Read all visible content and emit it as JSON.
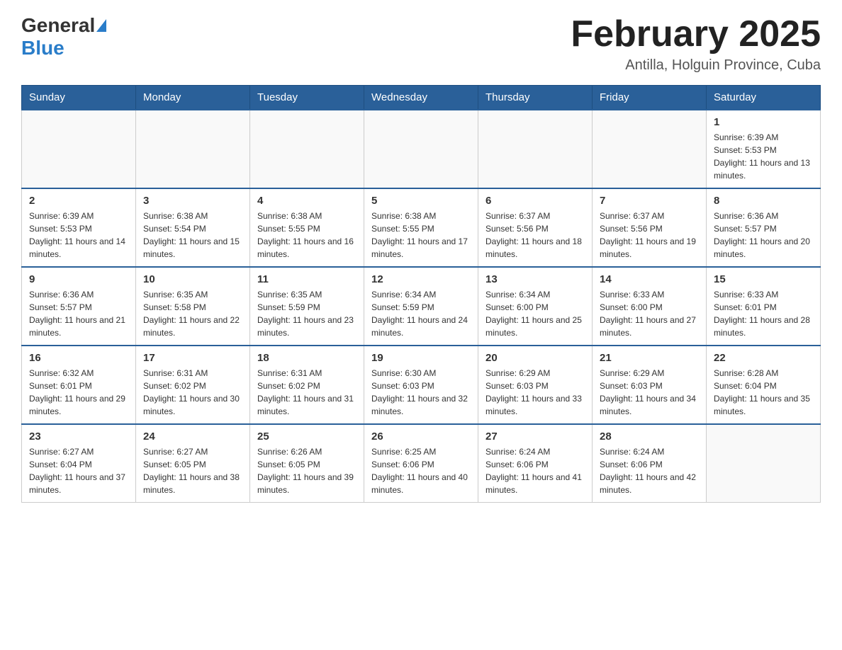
{
  "header": {
    "logo_general": "General",
    "logo_blue": "Blue",
    "month_title": "February 2025",
    "location": "Antilla, Holguin Province, Cuba"
  },
  "weekdays": [
    "Sunday",
    "Monday",
    "Tuesday",
    "Wednesday",
    "Thursday",
    "Friday",
    "Saturday"
  ],
  "weeks": [
    [
      {
        "day": "",
        "info": ""
      },
      {
        "day": "",
        "info": ""
      },
      {
        "day": "",
        "info": ""
      },
      {
        "day": "",
        "info": ""
      },
      {
        "day": "",
        "info": ""
      },
      {
        "day": "",
        "info": ""
      },
      {
        "day": "1",
        "info": "Sunrise: 6:39 AM\nSunset: 5:53 PM\nDaylight: 11 hours and 13 minutes."
      }
    ],
    [
      {
        "day": "2",
        "info": "Sunrise: 6:39 AM\nSunset: 5:53 PM\nDaylight: 11 hours and 14 minutes."
      },
      {
        "day": "3",
        "info": "Sunrise: 6:38 AM\nSunset: 5:54 PM\nDaylight: 11 hours and 15 minutes."
      },
      {
        "day": "4",
        "info": "Sunrise: 6:38 AM\nSunset: 5:55 PM\nDaylight: 11 hours and 16 minutes."
      },
      {
        "day": "5",
        "info": "Sunrise: 6:38 AM\nSunset: 5:55 PM\nDaylight: 11 hours and 17 minutes."
      },
      {
        "day": "6",
        "info": "Sunrise: 6:37 AM\nSunset: 5:56 PM\nDaylight: 11 hours and 18 minutes."
      },
      {
        "day": "7",
        "info": "Sunrise: 6:37 AM\nSunset: 5:56 PM\nDaylight: 11 hours and 19 minutes."
      },
      {
        "day": "8",
        "info": "Sunrise: 6:36 AM\nSunset: 5:57 PM\nDaylight: 11 hours and 20 minutes."
      }
    ],
    [
      {
        "day": "9",
        "info": "Sunrise: 6:36 AM\nSunset: 5:57 PM\nDaylight: 11 hours and 21 minutes."
      },
      {
        "day": "10",
        "info": "Sunrise: 6:35 AM\nSunset: 5:58 PM\nDaylight: 11 hours and 22 minutes."
      },
      {
        "day": "11",
        "info": "Sunrise: 6:35 AM\nSunset: 5:59 PM\nDaylight: 11 hours and 23 minutes."
      },
      {
        "day": "12",
        "info": "Sunrise: 6:34 AM\nSunset: 5:59 PM\nDaylight: 11 hours and 24 minutes."
      },
      {
        "day": "13",
        "info": "Sunrise: 6:34 AM\nSunset: 6:00 PM\nDaylight: 11 hours and 25 minutes."
      },
      {
        "day": "14",
        "info": "Sunrise: 6:33 AM\nSunset: 6:00 PM\nDaylight: 11 hours and 27 minutes."
      },
      {
        "day": "15",
        "info": "Sunrise: 6:33 AM\nSunset: 6:01 PM\nDaylight: 11 hours and 28 minutes."
      }
    ],
    [
      {
        "day": "16",
        "info": "Sunrise: 6:32 AM\nSunset: 6:01 PM\nDaylight: 11 hours and 29 minutes."
      },
      {
        "day": "17",
        "info": "Sunrise: 6:31 AM\nSunset: 6:02 PM\nDaylight: 11 hours and 30 minutes."
      },
      {
        "day": "18",
        "info": "Sunrise: 6:31 AM\nSunset: 6:02 PM\nDaylight: 11 hours and 31 minutes."
      },
      {
        "day": "19",
        "info": "Sunrise: 6:30 AM\nSunset: 6:03 PM\nDaylight: 11 hours and 32 minutes."
      },
      {
        "day": "20",
        "info": "Sunrise: 6:29 AM\nSunset: 6:03 PM\nDaylight: 11 hours and 33 minutes."
      },
      {
        "day": "21",
        "info": "Sunrise: 6:29 AM\nSunset: 6:03 PM\nDaylight: 11 hours and 34 minutes."
      },
      {
        "day": "22",
        "info": "Sunrise: 6:28 AM\nSunset: 6:04 PM\nDaylight: 11 hours and 35 minutes."
      }
    ],
    [
      {
        "day": "23",
        "info": "Sunrise: 6:27 AM\nSunset: 6:04 PM\nDaylight: 11 hours and 37 minutes."
      },
      {
        "day": "24",
        "info": "Sunrise: 6:27 AM\nSunset: 6:05 PM\nDaylight: 11 hours and 38 minutes."
      },
      {
        "day": "25",
        "info": "Sunrise: 6:26 AM\nSunset: 6:05 PM\nDaylight: 11 hours and 39 minutes."
      },
      {
        "day": "26",
        "info": "Sunrise: 6:25 AM\nSunset: 6:06 PM\nDaylight: 11 hours and 40 minutes."
      },
      {
        "day": "27",
        "info": "Sunrise: 6:24 AM\nSunset: 6:06 PM\nDaylight: 11 hours and 41 minutes."
      },
      {
        "day": "28",
        "info": "Sunrise: 6:24 AM\nSunset: 6:06 PM\nDaylight: 11 hours and 42 minutes."
      },
      {
        "day": "",
        "info": ""
      }
    ]
  ]
}
